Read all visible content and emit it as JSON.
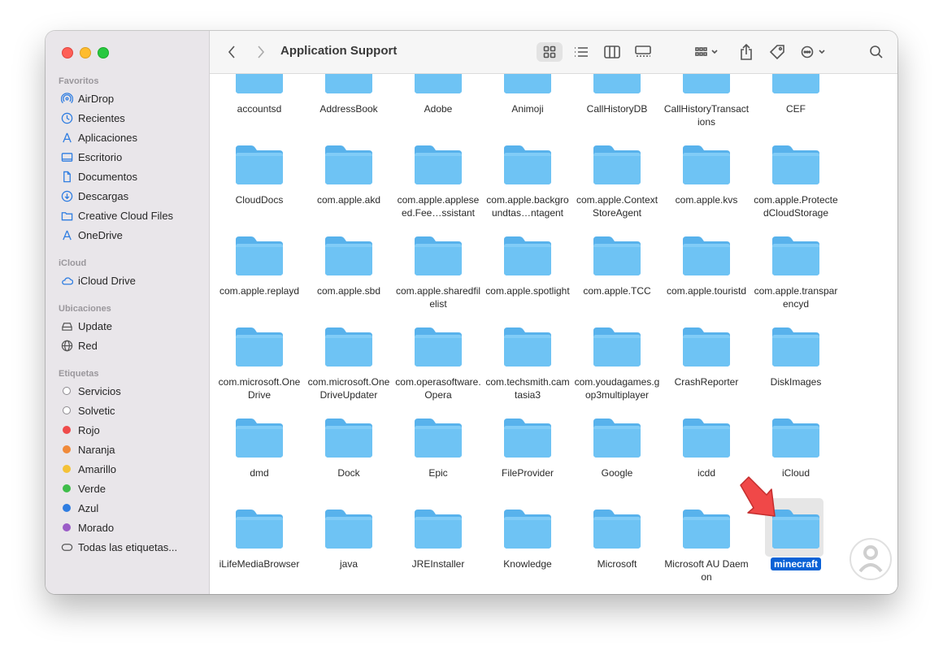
{
  "window": {
    "title": "Application Support"
  },
  "sidebar": {
    "favoritos": {
      "title": "Favoritos",
      "items": [
        {
          "label": "AirDrop",
          "icon": "airdrop-icon"
        },
        {
          "label": "Recientes",
          "icon": "clock-icon"
        },
        {
          "label": "Aplicaciones",
          "icon": "applications-icon"
        },
        {
          "label": "Escritorio",
          "icon": "desktop-icon"
        },
        {
          "label": "Documentos",
          "icon": "document-icon"
        },
        {
          "label": "Descargas",
          "icon": "download-icon"
        },
        {
          "label": "Creative Cloud Files",
          "icon": "folder-icon"
        },
        {
          "label": "OneDrive",
          "icon": "onedrive-icon"
        }
      ]
    },
    "icloud": {
      "title": "iCloud",
      "items": [
        {
          "label": "iCloud Drive",
          "icon": "cloud-icon"
        }
      ]
    },
    "ubicaciones": {
      "title": "Ubicaciones",
      "items": [
        {
          "label": "Update",
          "icon": "disk-icon"
        },
        {
          "label": "Red",
          "icon": "globe-icon"
        }
      ]
    },
    "etiquetas": {
      "title": "Etiquetas",
      "items": [
        {
          "label": "Servicios",
          "color": "#ffffff"
        },
        {
          "label": "Solvetic",
          "color": "#ffffff"
        },
        {
          "label": "Rojo",
          "color": "#ef4b4b"
        },
        {
          "label": "Naranja",
          "color": "#f08a3a"
        },
        {
          "label": "Amarillo",
          "color": "#f4c238"
        },
        {
          "label": "Verde",
          "color": "#3fbd4a"
        },
        {
          "label": "Azul",
          "color": "#2f7de1"
        },
        {
          "label": "Morado",
          "color": "#9b5cc7"
        },
        {
          "label": "Todas las etiquetas...",
          "icon": "tags-icon"
        }
      ]
    }
  },
  "folders": [
    [
      "accountsd",
      "AddressBook",
      "Adobe",
      "Animoji",
      "CallHistoryDB",
      "CallHistoryTransactions",
      "CEF"
    ],
    [
      "CloudDocs",
      "com.apple.akd",
      "com.apple.appleseed.Fee…ssistant",
      "com.apple.backgroundtas…ntagent",
      "com.apple.ContextStoreAgent",
      "com.apple.kvs",
      "com.apple.ProtectedCloudStorage"
    ],
    [
      "com.apple.replayd",
      "com.apple.sbd",
      "com.apple.sharedfilelist",
      "com.apple.spotlight",
      "com.apple.TCC",
      "com.apple.touristd",
      "com.apple.transparencyd"
    ],
    [
      "com.microsoft.OneDrive",
      "com.microsoft.OneDriveUpdater",
      "com.operasoftware.Opera",
      "com.techsmith.camtasia3",
      "com.youdagames.gop3multiplayer",
      "CrashReporter",
      "DiskImages"
    ],
    [
      "dmd",
      "Dock",
      "Epic",
      "FileProvider",
      "Google",
      "icdd",
      "iCloud"
    ],
    [
      "iLifeMediaBrowser",
      "java",
      "JREInstaller",
      "Knowledge",
      "Microsoft",
      "Microsoft AU Daemon",
      "minecraft"
    ]
  ],
  "selected_folder": "minecraft",
  "colors": {
    "folder": "#6ec3f4",
    "folder_tab": "#58b2ec",
    "selection": "#0b62d6",
    "arrow": "#f04848"
  }
}
